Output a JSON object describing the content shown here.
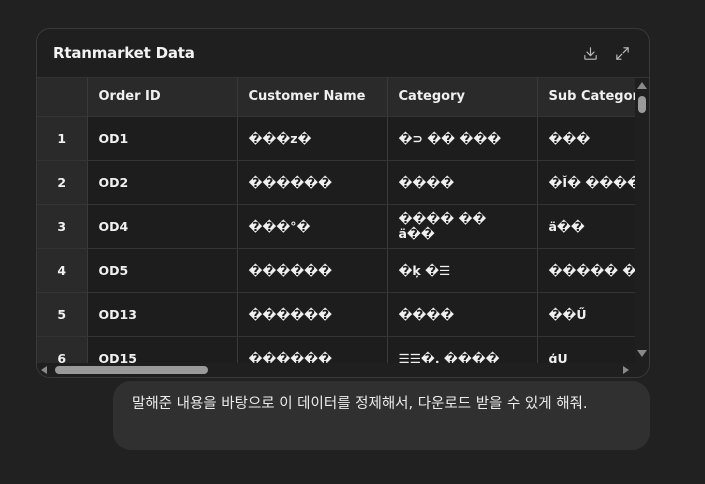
{
  "card": {
    "title": "Rtanmarket Data",
    "download_label": "download-icon",
    "expand_label": "expand-icon"
  },
  "table": {
    "columns": [
      "",
      "Order ID",
      "Customer Name",
      "Category",
      "Sub Categor"
    ],
    "rows": [
      {
        "idx": "1",
        "order_id": "OD1",
        "customer": "���z�",
        "category": "�⊃ �� ���",
        "sub": "���"
      },
      {
        "idx": "2",
        "order_id": "OD2",
        "customer": "������",
        "category": "����",
        "sub": "�Ĭ� ����"
      },
      {
        "idx": "3",
        "order_id": "OD4",
        "customer": "���°�",
        "category": "���� �� ä��",
        "sub": "ä��"
      },
      {
        "idx": "4",
        "order_id": "OD5",
        "customer": "������",
        "category": "�ķ �☰",
        "sub": "����� �"
      },
      {
        "idx": "5",
        "order_id": "OD13",
        "customer": "������",
        "category": "����",
        "sub": "��Ű"
      },
      {
        "idx": "6",
        "order_id": "OD15",
        "customer": "������",
        "category": "☰☰�, ����",
        "sub": "ģU"
      }
    ]
  },
  "message": {
    "text": "말해준 내용을 바탕으로 이 데이터를 정제해서, 다운로드 받을 수 있게 해줘."
  }
}
